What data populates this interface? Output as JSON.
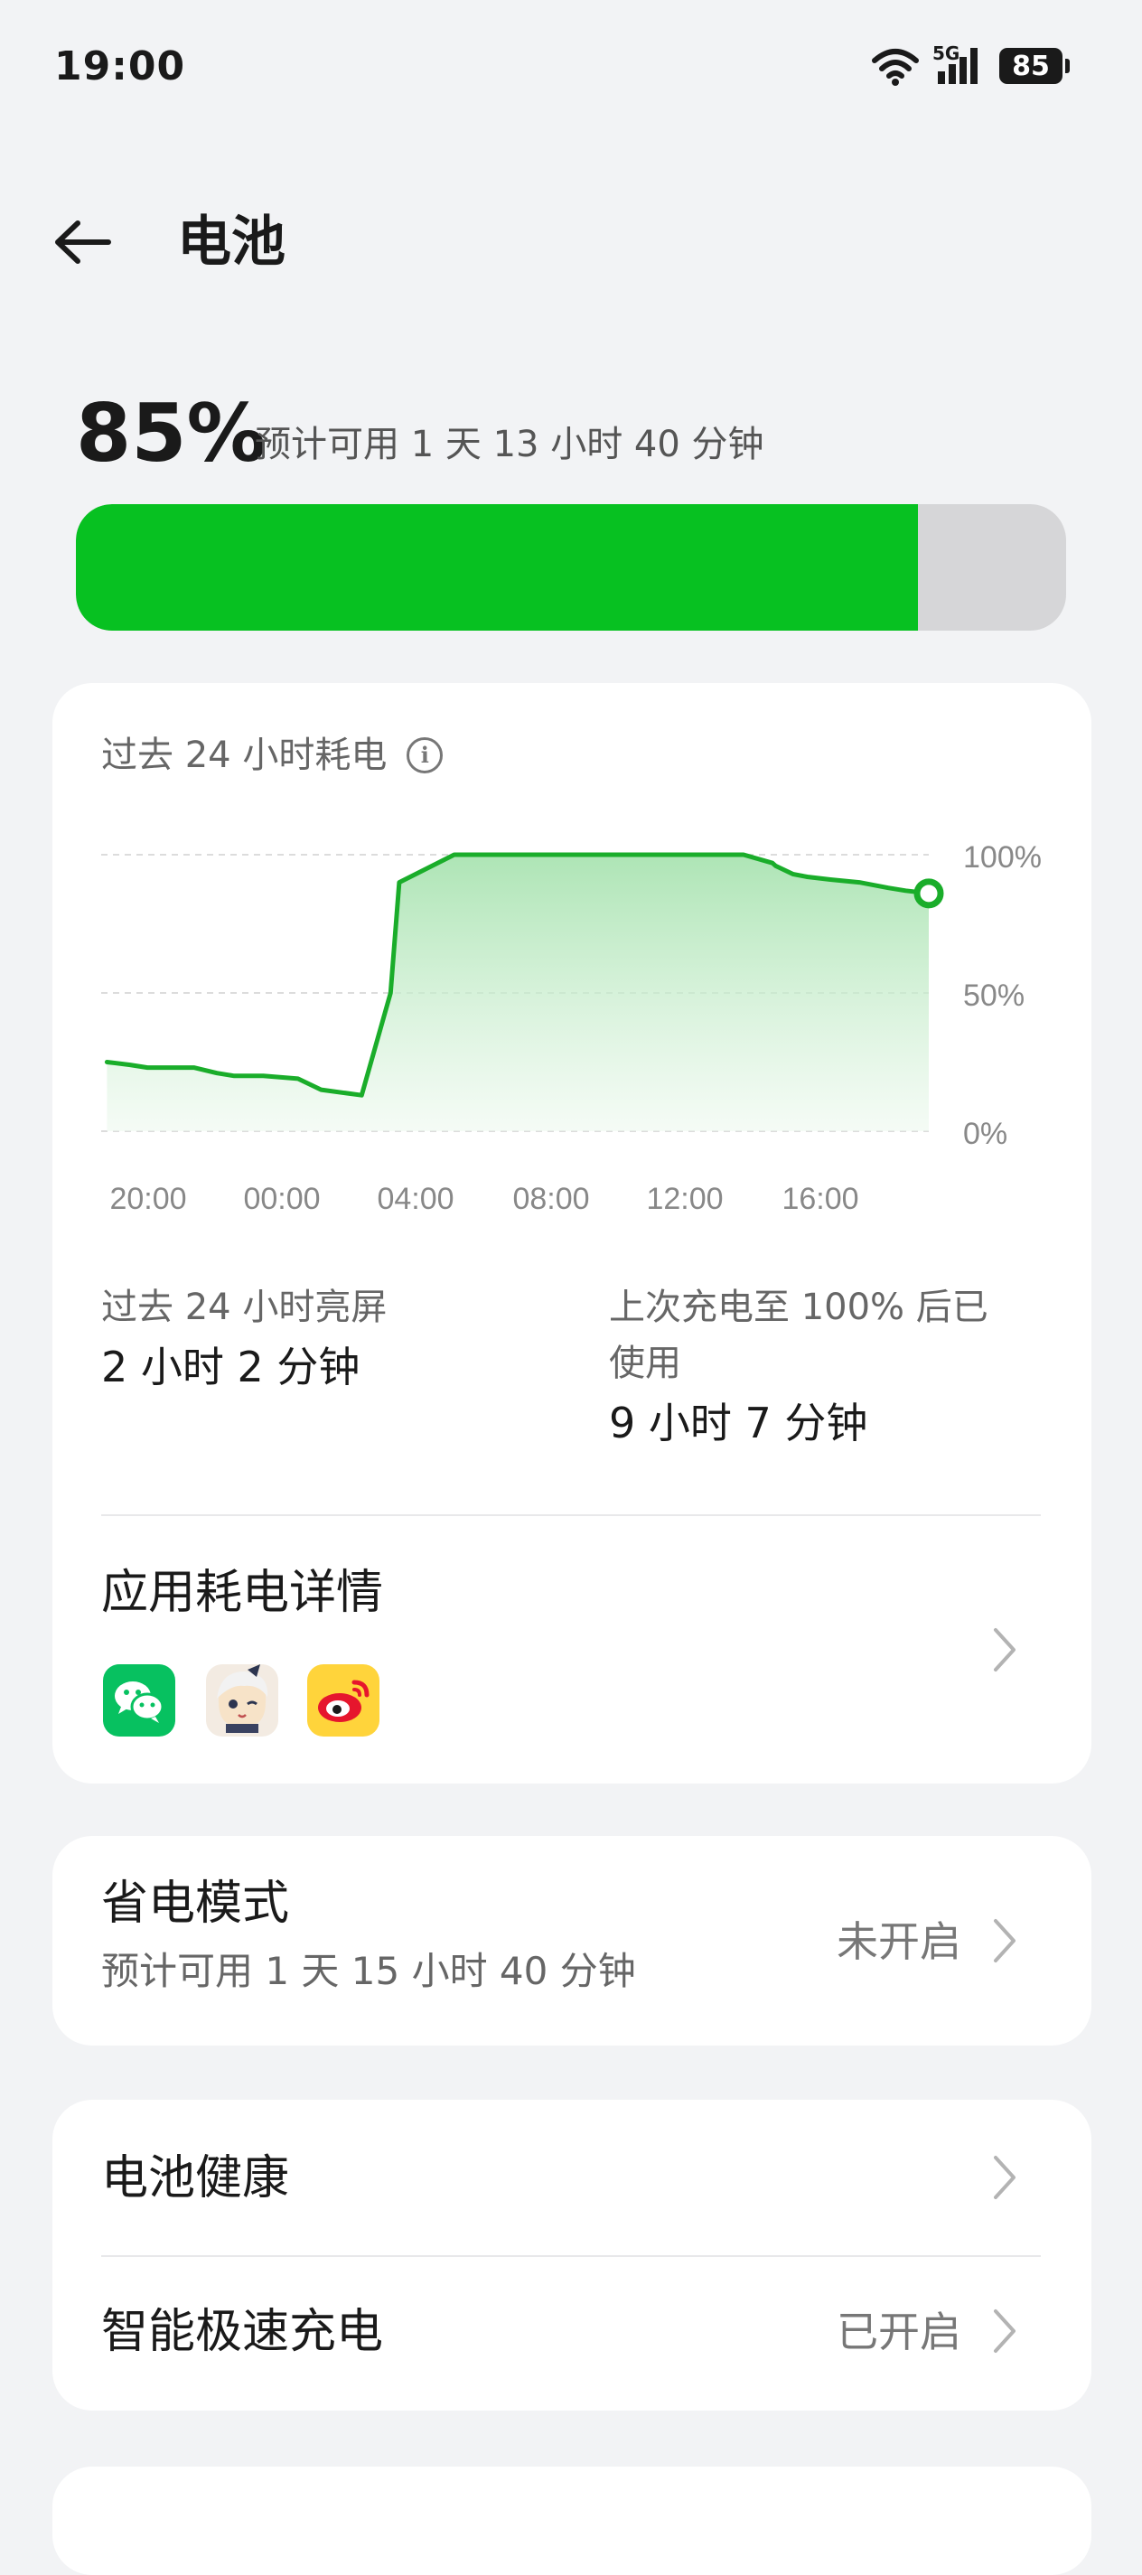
{
  "status_bar": {
    "time": "19:00",
    "network": "5G",
    "battery_level": "85",
    "icons": [
      "wifi-icon",
      "cellular-signal-icon",
      "battery-icon"
    ]
  },
  "header": {
    "title": "电池",
    "back_icon": "arrow-left-icon"
  },
  "battery": {
    "percent_text": "85%",
    "percent_value": 85,
    "estimate": "预计可用 1 天 13 小时 40 分钟",
    "fill_color": "#07c121"
  },
  "usage_card": {
    "chart_title": "过去 24 小时耗电",
    "screen_on_label": "过去 24 小时亮屏",
    "screen_on_value": "2 小时 2 分钟",
    "since_full_label_line1": "上次充电至 100% 后已",
    "since_full_label_line2": "使用",
    "since_full_value": "9 小时 7 分钟",
    "app_usage_title": "应用耗电详情",
    "apps": [
      "wechat-icon",
      "game-character-icon",
      "weibo-icon"
    ]
  },
  "chart_data": {
    "type": "area",
    "title": "过去 24 小时耗电",
    "x_tick_labels": [
      "20:00",
      "00:00",
      "04:00",
      "08:00",
      "12:00",
      "16:00"
    ],
    "y_tick_labels": [
      "100%",
      "50%",
      "0%"
    ],
    "ylim": [
      0,
      100
    ],
    "xlim_hours": [
      -24.2,
      0
    ],
    "line_color": "#1aad2a",
    "grid": "dashed horizontal",
    "series": [
      {
        "x_hours_ago": [
          -24.0,
          -23.2,
          -22.6,
          -21.0,
          -20.2,
          -19.6,
          -18.6,
          -17.4,
          -16.6,
          -15.2,
          -14.2,
          -13.9,
          -12.0,
          -10.1,
          -9.8,
          -8.0,
          -6.0,
          -4.0,
          -2.0,
          -1.0,
          -0.9,
          -0.3,
          0.2,
          1.0,
          2.0,
          3.0,
          3.6,
          4.4
        ],
        "values": [
          25,
          24,
          23,
          23,
          21,
          20,
          20,
          19,
          15,
          13,
          50,
          90,
          100,
          100,
          100,
          100,
          100,
          100,
          100,
          97,
          96,
          93,
          92,
          91,
          90,
          88,
          87,
          86
        ]
      }
    ]
  },
  "power_saving": {
    "title": "省电模式",
    "subtitle": "预计可用 1 天 15 小时 40 分钟",
    "status": "未开启"
  },
  "battery_health": {
    "title": "电池健康"
  },
  "fast_charge": {
    "title": "智能极速充电",
    "status": "已开启"
  }
}
